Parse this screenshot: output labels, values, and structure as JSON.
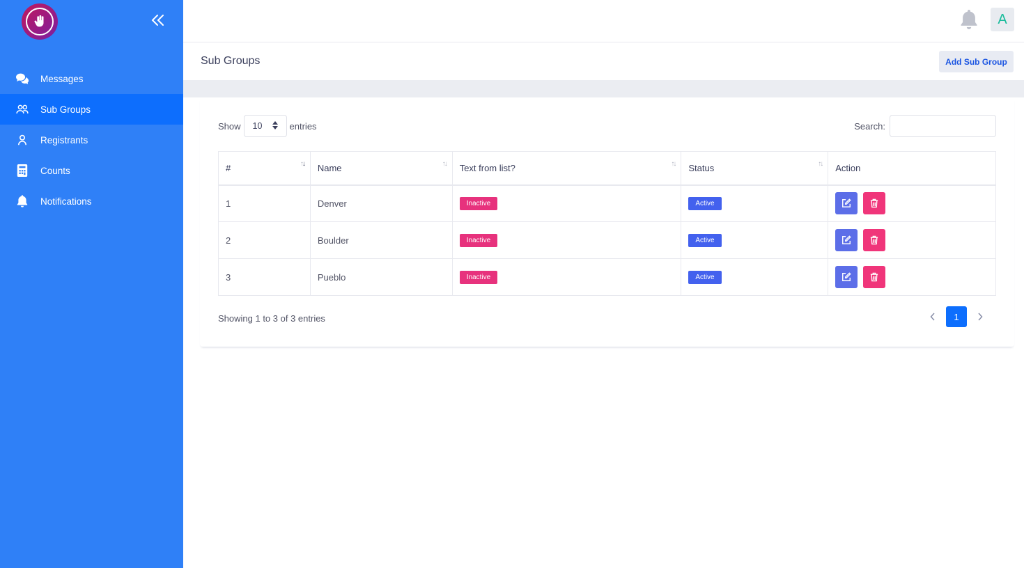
{
  "sidebar": {
    "items": [
      {
        "label": "Messages",
        "icon": "comments-icon"
      },
      {
        "label": "Sub Groups",
        "icon": "users-icon",
        "active": true
      },
      {
        "label": "Registrants",
        "icon": "user-icon"
      },
      {
        "label": "Counts",
        "icon": "calculator-icon"
      },
      {
        "label": "Notifications",
        "icon": "bell-icon"
      }
    ]
  },
  "topbar": {
    "avatar_initial": "A"
  },
  "page": {
    "title": "Sub Groups",
    "add_button": "Add Sub Group"
  },
  "table_controls": {
    "show_label": "Show",
    "entries_value": "10",
    "entries_label": "entries",
    "search_label": "Search:"
  },
  "table": {
    "headers": [
      "#",
      "Name",
      "Text from list?",
      "Status",
      "Action"
    ],
    "rows": [
      {
        "num": "1",
        "name": "Denver",
        "text_from_list": "Inactive",
        "status": "Active"
      },
      {
        "num": "2",
        "name": "Boulder",
        "text_from_list": "Inactive",
        "status": "Active"
      },
      {
        "num": "3",
        "name": "Pueblo",
        "text_from_list": "Inactive",
        "status": "Active"
      }
    ]
  },
  "footer": {
    "info": "Showing 1 to 3 of 3 entries",
    "current_page": "1"
  },
  "colors": {
    "sidebar": "#2f80f7",
    "sidebar_active": "#0d6efd",
    "badge_inactive": "#e7327d",
    "badge_active": "#4361ee",
    "edit_button": "#5c6ee8",
    "delete_button": "#f0357a"
  }
}
